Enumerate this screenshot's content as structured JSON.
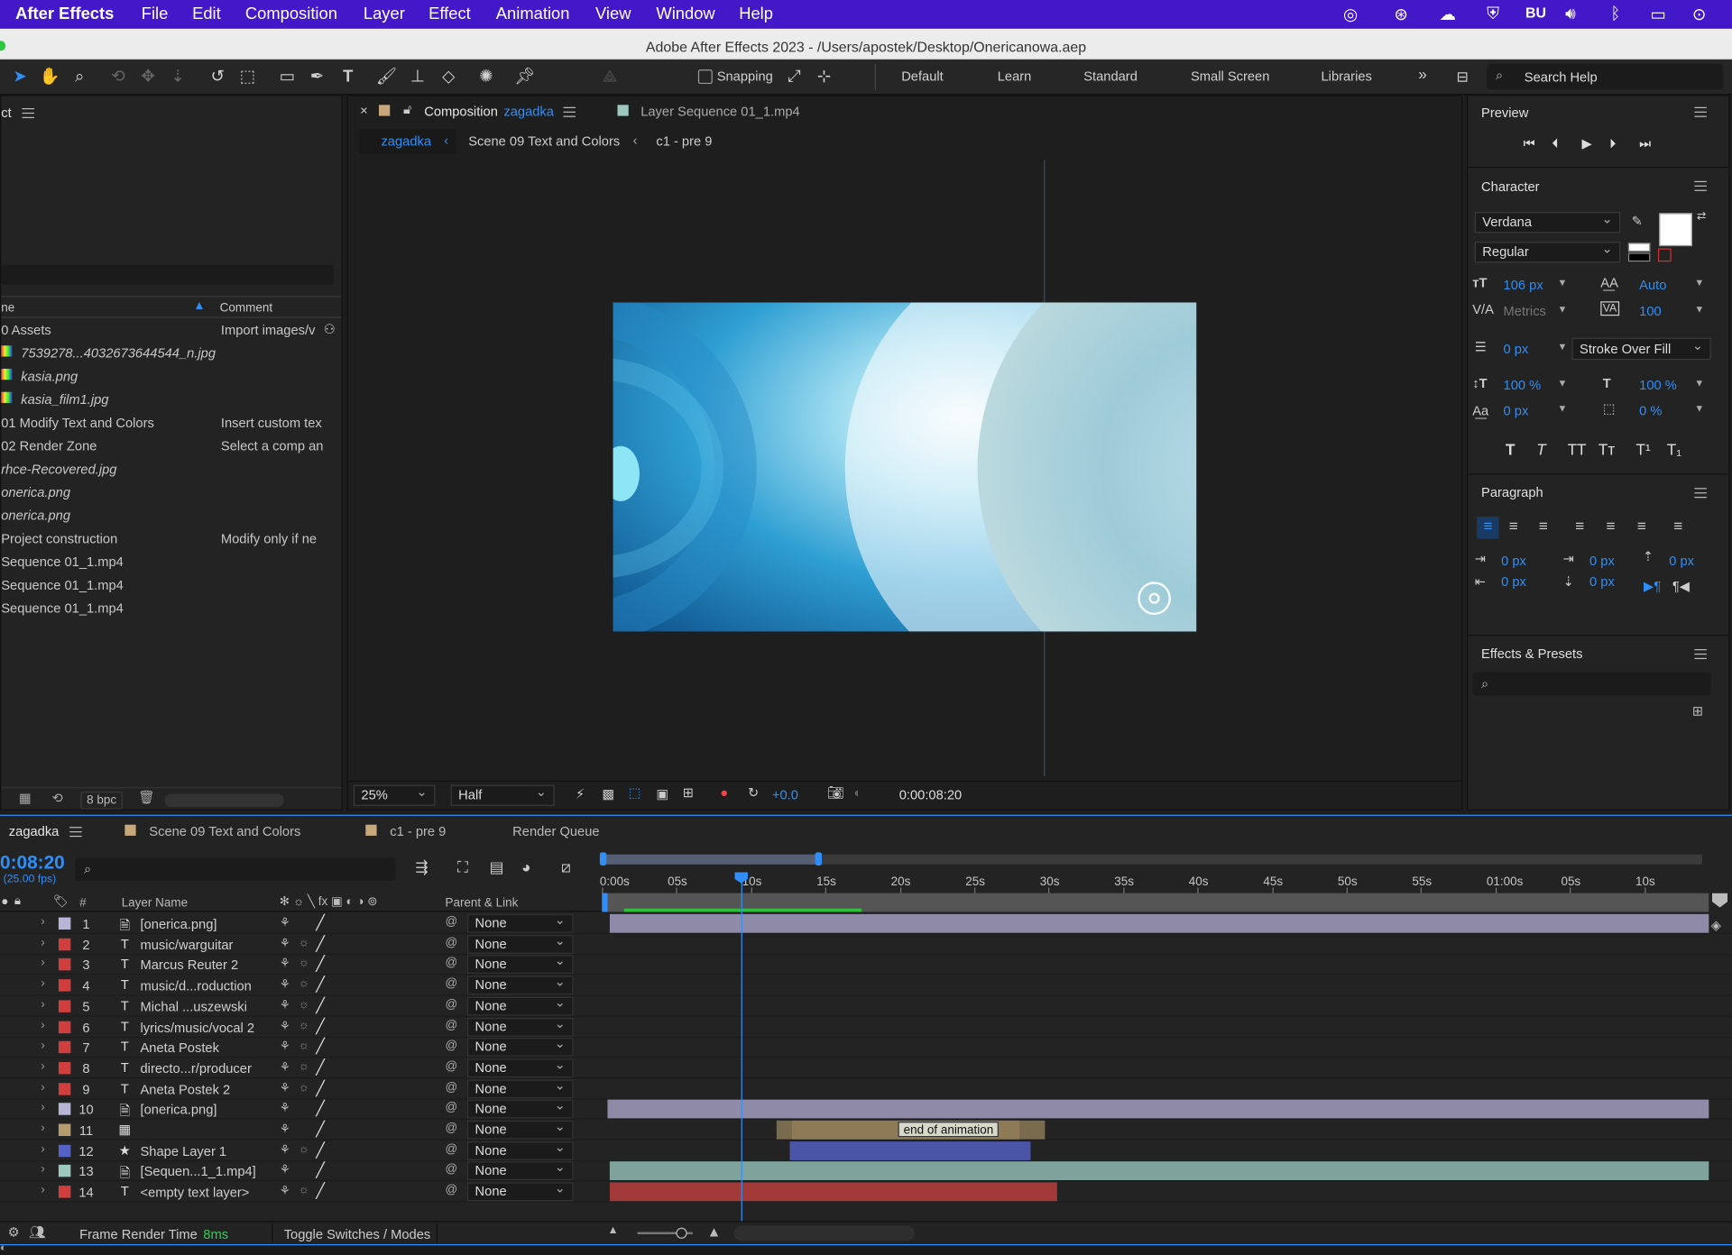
{
  "menubar": {
    "app": "After Effects",
    "items": [
      "File",
      "Edit",
      "Composition",
      "Layer",
      "Effect",
      "Animation",
      "View",
      "Window",
      "Help"
    ],
    "status_text": "BU"
  },
  "window": {
    "title": "Adobe After Effects 2023 - /Users/apostek/Desktop/Onericanowa.aep"
  },
  "toolbar": {
    "snapping": "Snapping",
    "workspaces": [
      "Default",
      "Learn",
      "Standard",
      "Small Screen",
      "Libraries"
    ],
    "search_help": "Search Help"
  },
  "project": {
    "tab": "ct",
    "col_name": "ne",
    "col_comment": "Comment",
    "bpc": "8 bpc",
    "items": [
      {
        "name": "0 Assets",
        "comment": "Import images/v",
        "type": "folder"
      },
      {
        "name": "7539278...4032673644544_n.jpg",
        "comment": "",
        "type": "image",
        "italic": true
      },
      {
        "name": "kasia.png",
        "comment": "",
        "type": "image",
        "italic": true
      },
      {
        "name": "kasia_film1.jpg",
        "comment": "",
        "type": "image",
        "italic": true
      },
      {
        "name": "01 Modify Text and Colors",
        "comment": "Insert custom tex",
        "type": "comp"
      },
      {
        "name": "02 Render Zone",
        "comment": "Select a comp an",
        "type": "comp"
      },
      {
        "name": "rhce-Recovered.jpg",
        "comment": "",
        "type": "image",
        "italic": true
      },
      {
        "name": "onerica.png",
        "comment": "",
        "type": "image",
        "italic": true
      },
      {
        "name": "onerica.png",
        "comment": "",
        "type": "image",
        "italic": true
      },
      {
        "name": "Project construction",
        "comment": "Modify only if ne",
        "type": "comp"
      },
      {
        "name": "Sequence 01_1.mp4",
        "comment": "",
        "type": "video"
      },
      {
        "name": "Sequence 01_1.mp4",
        "comment": "",
        "type": "video"
      },
      {
        "name": "Sequence 01_1.mp4",
        "comment": "",
        "type": "video"
      }
    ]
  },
  "viewer": {
    "comp_tab_prefix": "Composition",
    "comp_tab_name": "zagadka",
    "layer_tab": "Layer Sequence 01_1.mp4",
    "breadcrumbs": [
      "zagadka",
      "Scene 09 Text and Colors",
      "c1 - pre 9"
    ],
    "zoom": "25%",
    "resolution": "Half",
    "exposure": "+0.0",
    "timecode": "0:00:08:20"
  },
  "preview": {
    "title": "Preview"
  },
  "character": {
    "title": "Character",
    "font": "Verdana",
    "style": "Regular",
    "size": "106 px",
    "leading": "Auto",
    "kerning": "Metrics",
    "tracking": "100",
    "stroke_width": "0 px",
    "stroke_type": "Stroke Over Fill",
    "vscale": "100 %",
    "hscale": "100 %",
    "baseline": "0 px",
    "tsume": "0 %",
    "styles": [
      "T",
      "T",
      "TT",
      "Tт",
      "T¹",
      "T₁"
    ]
  },
  "paragraph": {
    "title": "Paragraph",
    "indent_left": "0 px",
    "indent_first": "0 px",
    "indent_right": "0 px",
    "space_before": "0 px",
    "space_after": "0 px"
  },
  "effects": {
    "title": "Effects & Presets"
  },
  "timeline": {
    "tabs": [
      "zagadka",
      "Scene 09 Text and Colors",
      "c1 - pre 9",
      "Render Queue"
    ],
    "timecode": "0:08:20",
    "fps": "(25.00 fps)",
    "col_layer_name": "Layer Name",
    "col_parent": "Parent & Link",
    "col_num": "#",
    "ruler": [
      "0:00s",
      "05s",
      "10s",
      "15s",
      "20s",
      "25s",
      "30s",
      "35s",
      "40s",
      "45s",
      "50s",
      "55s",
      "01:00s",
      "05s",
      "10s"
    ],
    "layers": [
      {
        "num": "1",
        "type": "img",
        "name": "[onerica.png]",
        "color": "#b7b4d8",
        "parent": "None"
      },
      {
        "num": "2",
        "type": "T",
        "name": "music/warguitar",
        "color": "#d03e3e",
        "parent": "None"
      },
      {
        "num": "3",
        "type": "T",
        "name": "Marcus Reuter 2",
        "color": "#d03e3e",
        "parent": "None"
      },
      {
        "num": "4",
        "type": "T",
        "name": "music/d...roduction",
        "color": "#d03e3e",
        "parent": "None"
      },
      {
        "num": "5",
        "type": "T",
        "name": "Michal ...uszewski",
        "color": "#d03e3e",
        "parent": "None"
      },
      {
        "num": "6",
        "type": "T",
        "name": "lyrics/music/vocal 2",
        "color": "#d03e3e",
        "parent": "None"
      },
      {
        "num": "7",
        "type": "T",
        "name": "Aneta Postek",
        "color": "#d03e3e",
        "parent": "None"
      },
      {
        "num": "8",
        "type": "T",
        "name": "directo...r/producer",
        "color": "#d03e3e",
        "parent": "None"
      },
      {
        "num": "9",
        "type": "T",
        "name": "Aneta Postek 2",
        "color": "#d03e3e",
        "parent": "None"
      },
      {
        "num": "10",
        "type": "img",
        "name": "[onerica.png]",
        "color": "#b7b4d8",
        "parent": "None"
      },
      {
        "num": "11",
        "type": "comp",
        "name": "",
        "color": "#b59c6a",
        "parent": "None"
      },
      {
        "num": "12",
        "type": "star",
        "name": "Shape Layer 1",
        "color": "#5563c9",
        "parent": "None"
      },
      {
        "num": "13",
        "type": "vid",
        "name": "[Sequen...1_1.mp4]",
        "color": "#9ec9bf",
        "parent": "None"
      },
      {
        "num": "14",
        "type": "T",
        "name": "<empty text layer>",
        "color": "#d03e3e",
        "parent": "None"
      }
    ],
    "marker_label": "end of animation",
    "footer": {
      "render_label": "Frame Render Time",
      "render_value": "8ms",
      "toggle": "Toggle Switches / Modes"
    }
  }
}
